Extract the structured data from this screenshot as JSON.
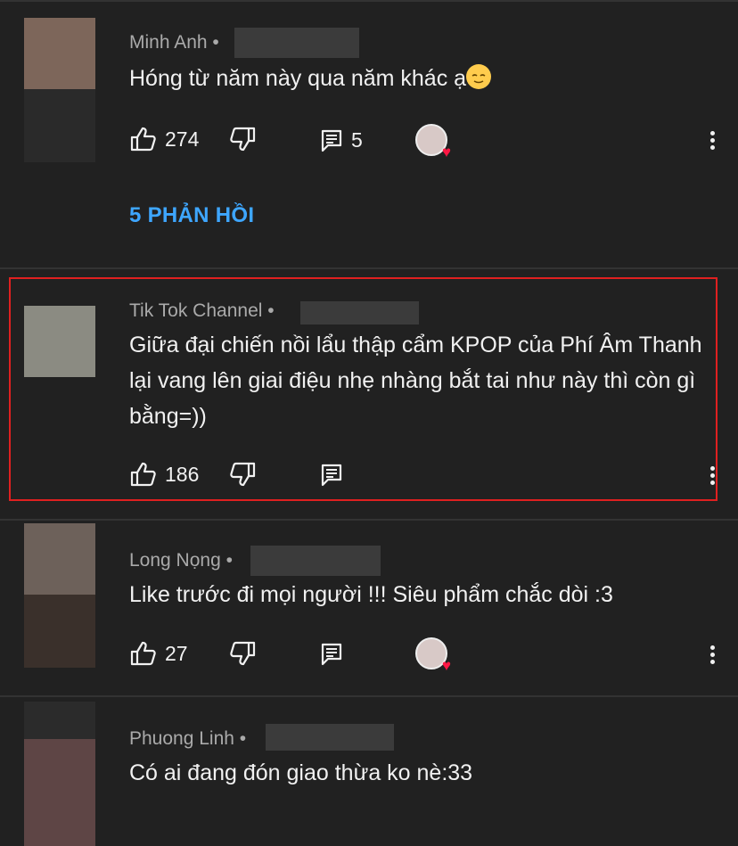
{
  "comments": [
    {
      "author": "Minh Anh",
      "separator": "•",
      "text": "Hóng từ năm này qua năm khác ạ",
      "emoji": "relieved-face",
      "likes": "274",
      "reply_count": "5",
      "replies_link": "5 PHẢN HỒI",
      "creator_heart": true,
      "avatar_color": "#7d665a"
    },
    {
      "author": "Tik Tok Channel",
      "separator": "•",
      "text": "Giữa đại chiến  nồi lẩu thập cẩm KPOP của Phí Âm Thanh lại vang lên giai điệu nhẹ nhàng bắt tai như này thì còn gì bằng=))",
      "likes": "186",
      "highlighted": true,
      "avatar_color": "#8b8b82"
    },
    {
      "author": "Long Nọng",
      "separator": "•",
      "text": "Like trước đi mọi người !!! Siêu phẩm chắc dòi :3",
      "likes": "27",
      "creator_heart": true,
      "avatar_color": "#6d615a"
    },
    {
      "author": "Phuong Linh",
      "separator": "•",
      "text": "Có ai đang đón giao thừa ko nè:33",
      "avatar_color": "#5e4545"
    }
  ],
  "icons": {
    "like": "thumbs-up-icon",
    "dislike": "thumbs-down-icon",
    "reply": "reply-comment-icon",
    "menu": "more-vertical-icon",
    "heart": "creator-heart-icon"
  },
  "colors": {
    "background": "#212121",
    "link": "#3ea6ff",
    "highlight_border": "#e02020",
    "heart": "#ff1744"
  }
}
